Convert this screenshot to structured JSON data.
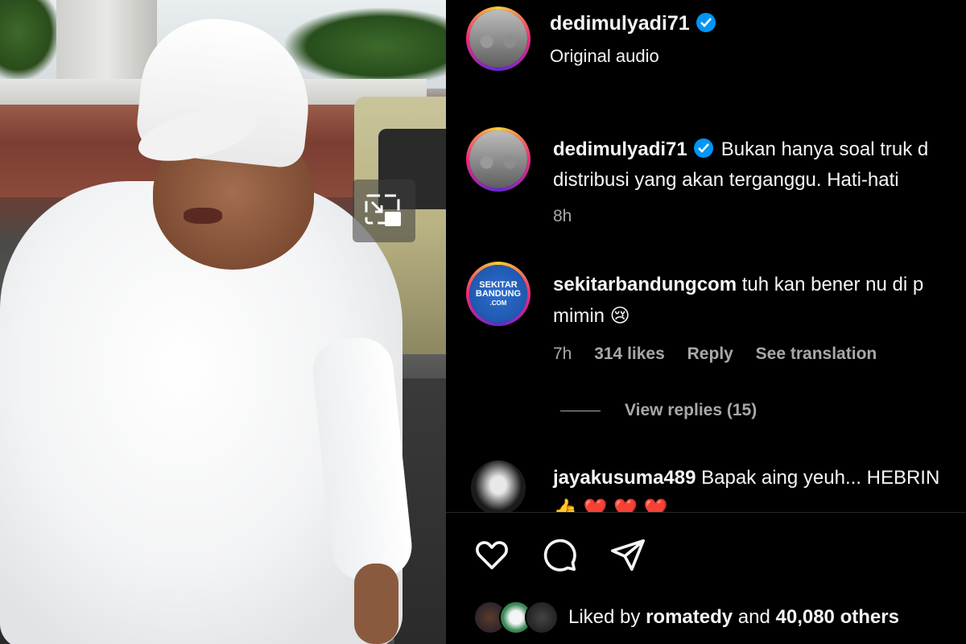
{
  "header": {
    "username": "dedimulyadi71",
    "subtitle": "Original audio"
  },
  "comments": [
    {
      "username": "dedimulyadi71",
      "verified": true,
      "line1": "Bukan hanya soal truk d",
      "line2": "distribusi yang akan terganggu. Hati-hati",
      "time": "8h"
    },
    {
      "username": "sekitarbandungcom",
      "avatar_text": [
        "SEKITAR",
        "BANDUNG",
        ".COM"
      ],
      "line1": "tuh kan bener nu di p",
      "line2": "mimin",
      "emoji": "😢",
      "time": "7h",
      "likes": "314 likes",
      "reply": "Reply",
      "translate": "See translation",
      "view_replies": "View replies (15)"
    },
    {
      "username": "jayakusuma489",
      "line1": "Bapak aing yeuh... HEBRIN",
      "line2_emoji": "👍 ❤️ ❤️ ❤️"
    }
  ],
  "likes": {
    "prefix": "Liked by",
    "user": "romatedy",
    "middle": "and",
    "count": "40,080 others"
  },
  "icons": [
    "heart-icon",
    "comment-icon",
    "share-icon",
    "pip-icon",
    "verified-icon"
  ],
  "colors": {
    "verified": "#0095f6",
    "background": "#000000",
    "muted": "#a8a8a8"
  }
}
